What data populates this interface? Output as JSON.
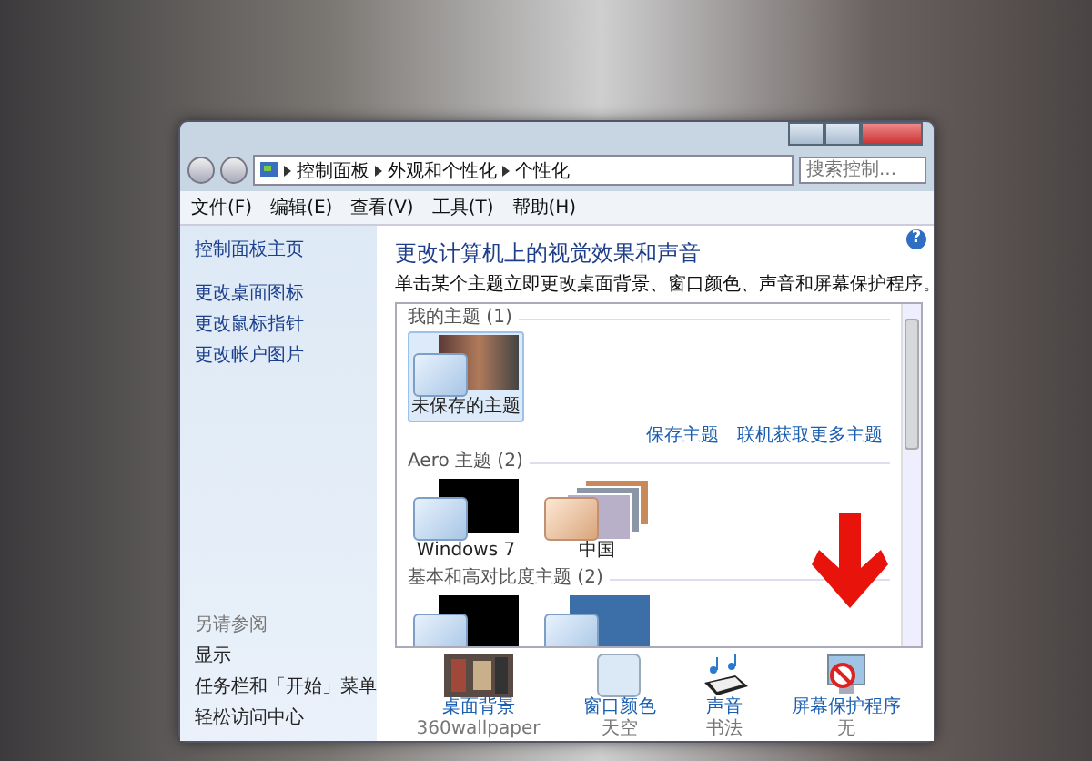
{
  "address": {
    "breadcrumbs": [
      "控制面板",
      "外观和个性化",
      "个性化"
    ],
    "search": {
      "placeholder": "搜索控制..."
    }
  },
  "menu": [
    "文件(F)",
    "编辑(E)",
    "查看(V)",
    "工具(T)",
    "帮助(H)"
  ],
  "sidebar": {
    "home": "控制面板主页",
    "links": [
      "更改桌面图标",
      "更改鼠标指针",
      "更改帐户图片"
    ],
    "see_also_title": "另请参阅",
    "see_also": [
      "显示",
      "任务栏和「开始」菜单",
      "轻松访问中心"
    ]
  },
  "heading": "更改计算机上的视觉效果和声音",
  "description": "单击某个主题立即更改桌面背景、窗口颜色、声音和屏幕保护程序。",
  "sections": [
    {
      "title": "我的主题 (1)",
      "tiles": [
        {
          "label": "未保存的主题",
          "kind": "photo",
          "selected": true
        }
      ],
      "links": [
        "保存主题",
        "联机获取更多主题"
      ]
    },
    {
      "title": "Aero 主题 (2)",
      "tiles": [
        {
          "label": "Windows 7",
          "kind": "dark",
          "selected": false
        },
        {
          "label": "中国",
          "kind": "stack",
          "selected": false
        }
      ]
    },
    {
      "title": "基本和高对比度主题 (2)",
      "tiles": [
        {
          "kind": "dark",
          "selected": false
        },
        {
          "kind": "blue",
          "selected": false
        }
      ]
    }
  ],
  "bottom": [
    {
      "kind": "background",
      "label": "桌面背景",
      "value": "360wallpaper"
    },
    {
      "kind": "color",
      "label": "窗口颜色",
      "value": "天空"
    },
    {
      "kind": "sound",
      "label": "声音",
      "value": "书法"
    },
    {
      "kind": "screensaver",
      "label": "屏幕保护程序",
      "value": "无"
    }
  ],
  "help": "?"
}
